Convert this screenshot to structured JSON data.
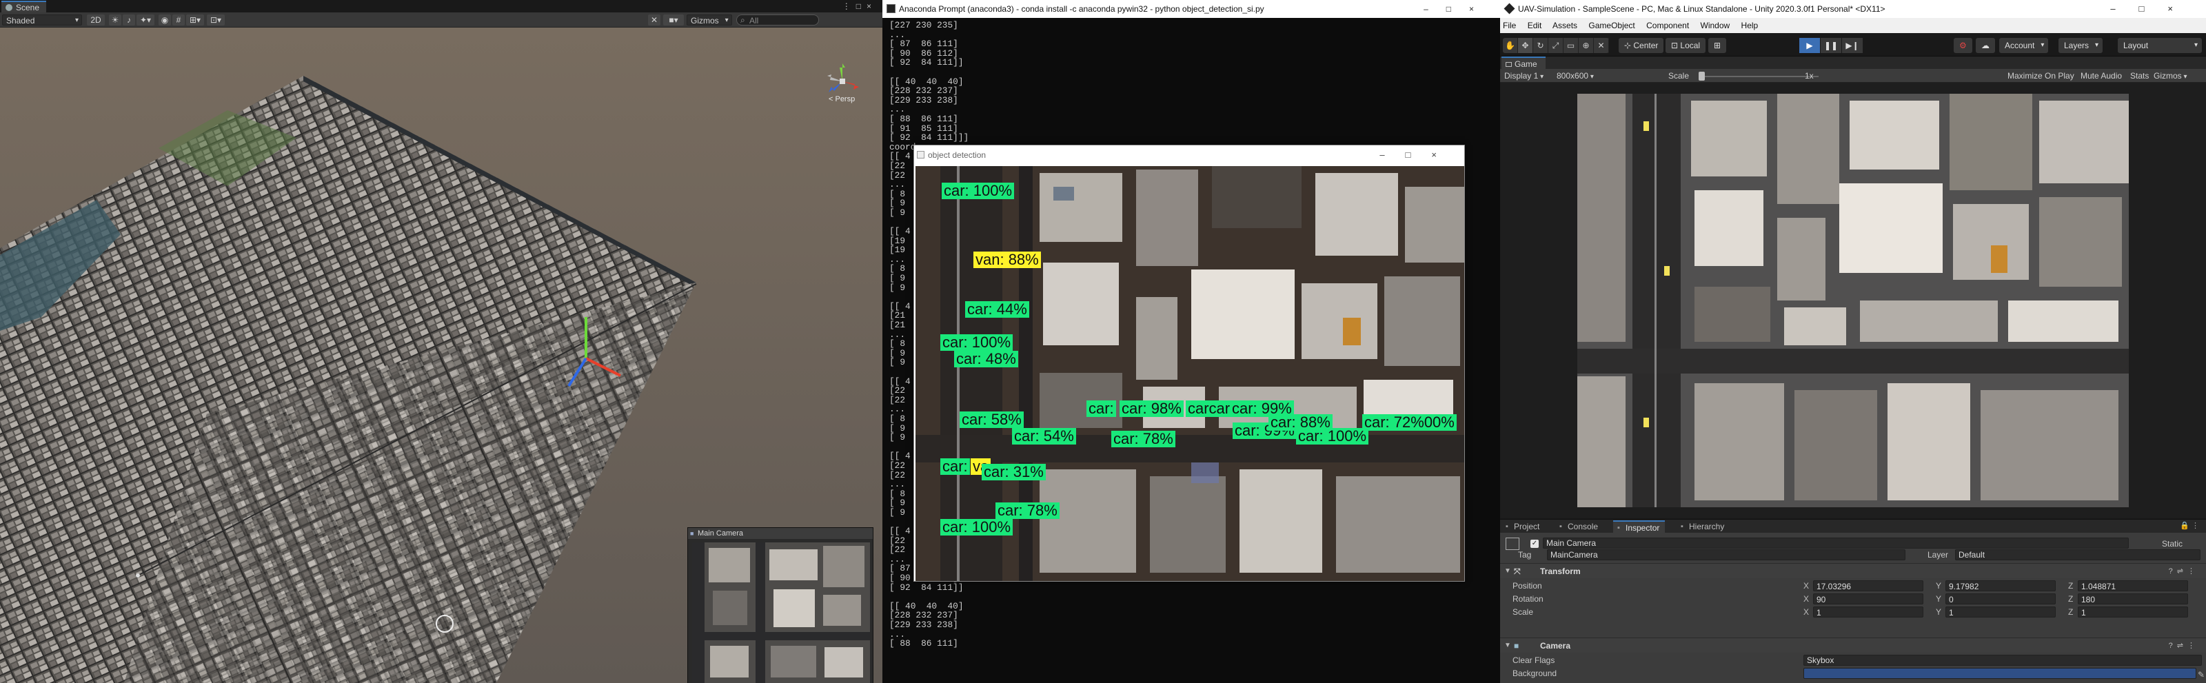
{
  "scene": {
    "tab_label": "Scene",
    "shading": "Shaded",
    "mode_2d": "2D",
    "gizmos": "Gizmos",
    "search_placeholder": "All",
    "persp_label": "< Persp",
    "mini_camera_title": "Main Camera"
  },
  "console": {
    "title": "Anaconda Prompt (anaconda3) - conda  install -c anaconda pywin32 - python  object_detection_si.py",
    "lines": [
      "[227 230 235]",
      "...",
      "[ 87  86 111]",
      "[ 90  86 112]",
      "[ 92  84 111]]",
      "",
      "[[ 40  40  40]",
      "[228 232 237]",
      "[229 233 238]",
      "...",
      "[ 88  86 111]",
      "[ 91  85 111]",
      "[ 92  84 111]]]",
      "coord",
      "[[ 4",
      "[22",
      "[22",
      "...",
      "[ 8",
      "[ 9",
      "[ 9",
      "",
      "[[ 4",
      "[19",
      "[19",
      "...",
      "[ 8",
      "[ 9",
      "[ 9",
      "",
      "[[ 4",
      "[21",
      "[21",
      "...",
      "[ 8",
      "[ 9",
      "[ 9",
      "",
      "[[ 4",
      "[22",
      "[22",
      "...",
      "[ 8",
      "[ 9",
      "[ 9",
      "",
      "[[ 4",
      "[22",
      "[22",
      "...",
      "[ 8",
      "[ 9",
      "[ 9",
      "",
      "[[ 4",
      "[22",
      "[22",
      "...",
      "[ 87  86 111]",
      "[ 90  86 112]",
      "[ 92  84 111]]",
      "",
      "[[ 40  40  40]",
      "[228 232 237]",
      "[229 233 238]",
      "...",
      "[ 88  86 111]"
    ]
  },
  "detection": {
    "title": "object detection",
    "labels": [
      {
        "text": "car: 100%",
        "cls": "car"
      },
      {
        "text": "van: 88%",
        "cls": "van"
      },
      {
        "text": "car: 44%",
        "cls": "car"
      },
      {
        "text": "car: 100%",
        "cls": "car"
      },
      {
        "text": "car: 48%",
        "cls": "car"
      },
      {
        "text": "car: 58%",
        "cls": "car"
      },
      {
        "text": "car: 54%",
        "cls": "car"
      },
      {
        "text": "car:",
        "cls": "car"
      },
      {
        "text": "car: 98%",
        "cls": "car"
      },
      {
        "text": "carcar",
        "cls": "car"
      },
      {
        "text": "car: 99%",
        "cls": "car"
      },
      {
        "text": "car: 78%",
        "cls": "car"
      },
      {
        "text": "car: 99%",
        "cls": "car"
      },
      {
        "text": "car: 88%",
        "cls": "car"
      },
      {
        "text": "car: 100%",
        "cls": "car"
      },
      {
        "text": "car: 72%00%",
        "cls": "car"
      },
      {
        "text": "car:",
        "cls": "car"
      },
      {
        "text": "va",
        "cls": "van"
      },
      {
        "text": "car: 31%",
        "cls": "car"
      },
      {
        "text": "car: 78%",
        "cls": "car"
      },
      {
        "text": "car: 100%",
        "cls": "car"
      }
    ]
  },
  "unity": {
    "title": "UAV-Simulation - SampleScene - PC, Mac & Linux Standalone - Unity 2020.3.0f1 Personal* <DX11>",
    "menu": [
      "File",
      "Edit",
      "Assets",
      "GameObject",
      "Component",
      "Window",
      "Help"
    ],
    "toolbar": {
      "center": "Center",
      "local": "Local",
      "account": "Account",
      "layers": "Layers",
      "layout": "Layout"
    },
    "game": {
      "tab_label": "Game",
      "display": "Display 1",
      "resolution": "800x600",
      "scale_label": "Scale",
      "scale_value": "1x",
      "maximize": "Maximize On Play",
      "mute": "Mute Audio",
      "stats": "Stats",
      "gizmos": "Gizmos"
    },
    "bottom_tabs": [
      "Project",
      "Console",
      "Inspector",
      "Hierarchy"
    ],
    "inspector": {
      "object_name": "Main Camera",
      "static_label": "Static",
      "tag_label": "Tag",
      "tag_value": "MainCamera",
      "layer_label": "Layer",
      "layer_value": "Default",
      "transform_header": "Transform",
      "position_label": "Position",
      "rotation_label": "Rotation",
      "scale_label": "Scale",
      "pos_x": "17.03296",
      "pos_y": "9.17982",
      "pos_z": "1.048871",
      "rot_x": "90",
      "rot_y": "0",
      "rot_z": "180",
      "scl_x": "1",
      "scl_y": "1",
      "scl_z": "1",
      "camera_header": "Camera",
      "clear_flags_label": "Clear Flags",
      "clear_flags_value": "Skybox",
      "background_label": "Background"
    },
    "colors": {
      "accent": "#3a79bb",
      "play_on": "#3b6fb4",
      "car_label": "#19e87a",
      "van_label": "#fff22a"
    }
  }
}
